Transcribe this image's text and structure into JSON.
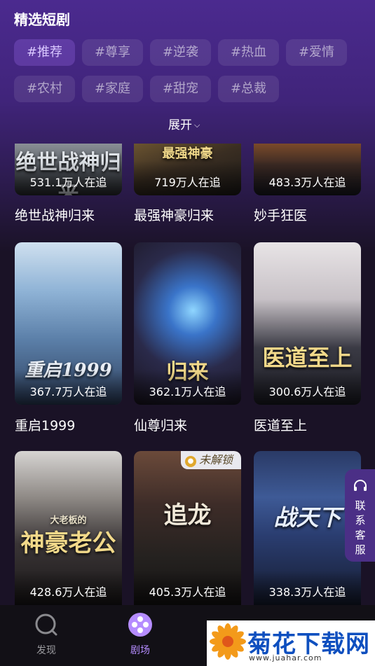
{
  "header": {
    "title": "精选短剧"
  },
  "tags": [
    "#推荐",
    "#尊享",
    "#逆袭",
    "#热血",
    "#爱情",
    "#农村",
    "#家庭",
    "#甜宠",
    "#总裁"
  ],
  "expand_label": "展开",
  "row1": [
    {
      "title": "绝世战神归来",
      "watchers": "531.1万人在追",
      "overlay": "绝世战神归来"
    },
    {
      "title": "最强神豪归来",
      "watchers": "719万人在追",
      "overlay": "最强神豪"
    },
    {
      "title": "妙手狂医",
      "watchers": "483.3万人在追",
      "overlay": ""
    }
  ],
  "row2": [
    {
      "title": "重启1999",
      "watchers": "367.7万人在追",
      "overlay": "重启1999"
    },
    {
      "title": "仙尊归来",
      "watchers": "362.1万人在追",
      "overlay": "归来"
    },
    {
      "title": "医道至上",
      "watchers": "300.6万人在追",
      "overlay": "医道至上"
    }
  ],
  "row3": [
    {
      "watchers": "428.6万人在追",
      "overlay": "神豪老公",
      "overlay_top": "大老板的"
    },
    {
      "watchers": "405.3万人在追",
      "overlay": "追龙",
      "badge": "未解锁"
    },
    {
      "watchers": "338.3万人在追",
      "overlay": "战天下"
    }
  ],
  "side_tab": {
    "label": "联系客服"
  },
  "nav": [
    {
      "label": "发现",
      "icon": "discover-icon"
    },
    {
      "label": "剧场",
      "icon": "theater-icon"
    }
  ],
  "watermark": {
    "main": "菊花下载网",
    "url": "www.juahar.com"
  },
  "colors": {
    "accent": "#b58cff",
    "nav_bg": "#121016"
  }
}
